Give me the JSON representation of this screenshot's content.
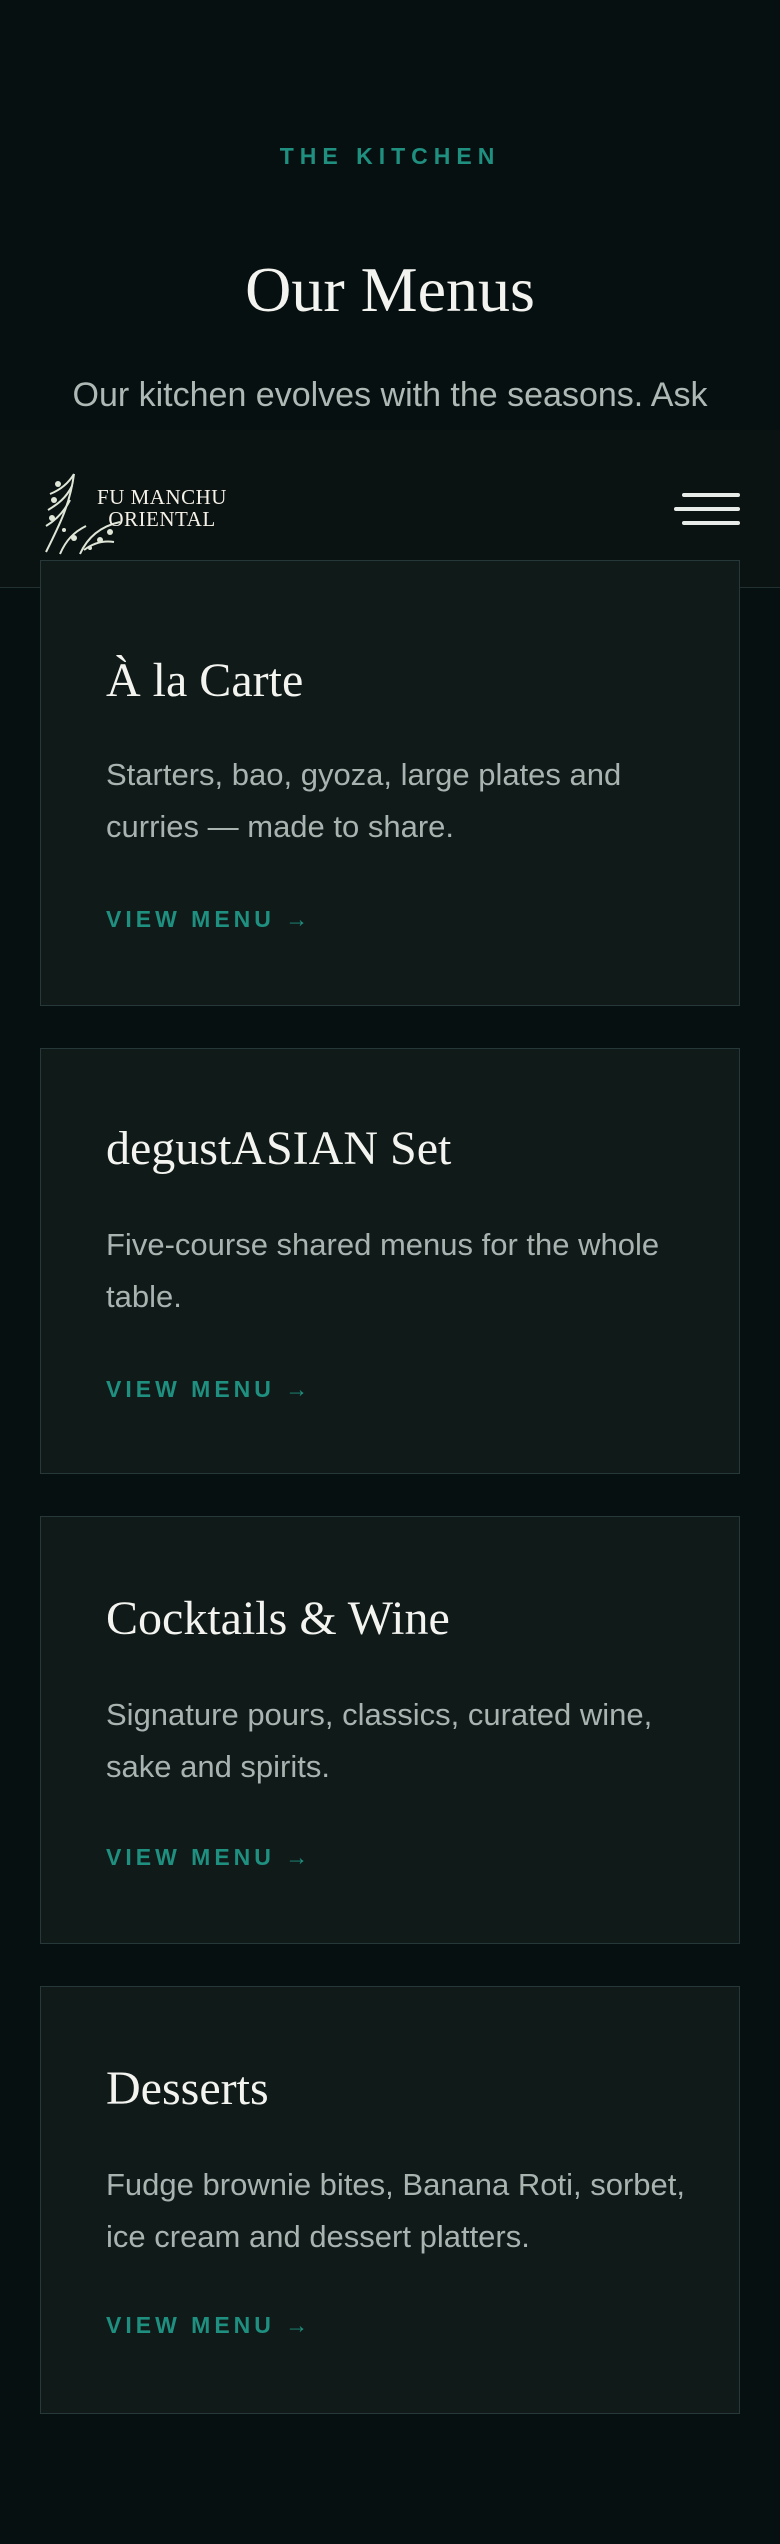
{
  "intro": {
    "eyebrow": "THE KITCHEN",
    "title": "Our Menus",
    "lead": "Our kitchen evolves with the seasons. Ask"
  },
  "header": {
    "logo_line1": "FU MANCHU",
    "logo_line2": "ORIENTAL",
    "menu_icon": "hamburger-icon"
  },
  "cards": [
    {
      "title": "À la Carte",
      "description": "Starters, bao, gyoza, large plates and curries — made to share.",
      "link": "VIEW MENU →"
    },
    {
      "title": "degustASIAN Set",
      "description": "Five-course shared menus for the whole table.",
      "link": "VIEW MENU →"
    },
    {
      "title": "Cocktails & Wine",
      "description": "Signature pours, classics, curated wine, sake and spirits.",
      "link": "VIEW MENU →"
    },
    {
      "title": "Desserts",
      "description": "Fudge brownie bites, Banana Roti, sorbet, ice cream and dessert platters.",
      "link": "VIEW MENU →"
    }
  ],
  "colors": {
    "background": "#071010",
    "card": "#0f1a19",
    "accent": "#1f8f80",
    "text": "#f3f3ef",
    "muted": "#a9b3b0"
  }
}
